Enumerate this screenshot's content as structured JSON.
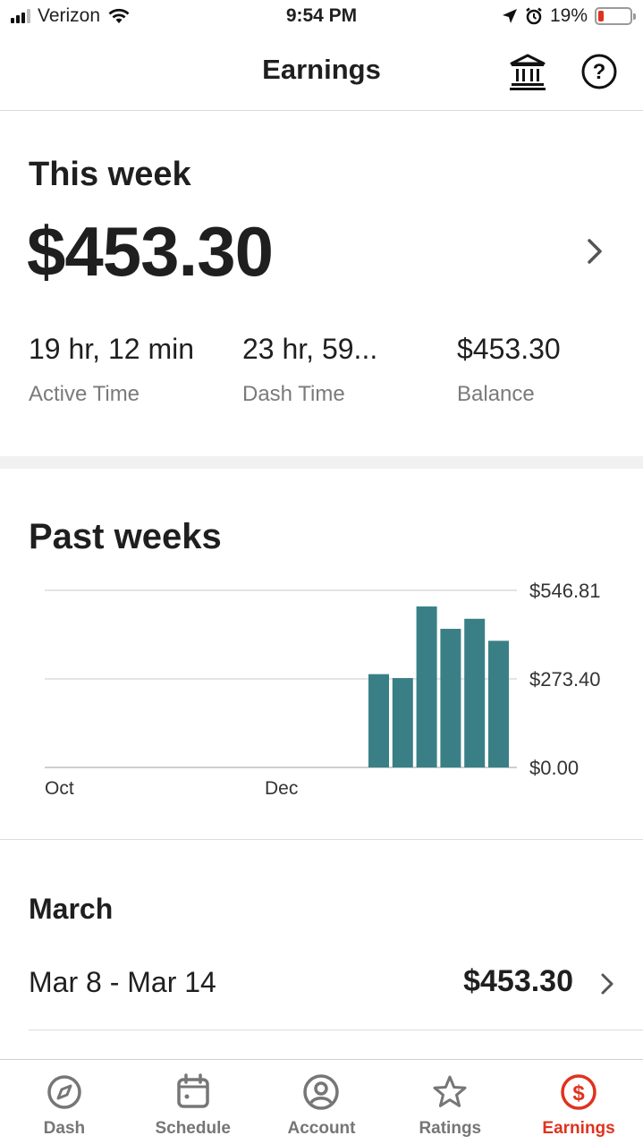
{
  "status_bar": {
    "carrier": "Verizon",
    "time": "9:54 PM",
    "battery": "19%",
    "battery_level": 0.19
  },
  "header": {
    "title": "Earnings",
    "icons": [
      "bank-icon",
      "help-icon"
    ]
  },
  "this_week": {
    "title": "This week",
    "amount": "$453.30",
    "stats": [
      {
        "value": "19 hr, 12 min",
        "label": "Active Time"
      },
      {
        "value": "23 hr, 59...",
        "label": "Dash Time"
      },
      {
        "value": "$453.30",
        "label": "Balance"
      }
    ]
  },
  "past_weeks": {
    "title": "Past weeks"
  },
  "chart_data": {
    "type": "bar",
    "categories": [
      "",
      "",
      "",
      "",
      "",
      ""
    ],
    "values": [
      288,
      276,
      497,
      428,
      459,
      391
    ],
    "title": "",
    "xlabel": "",
    "ylabel": "",
    "ylim": [
      0,
      546.81
    ],
    "y_ticks": [
      "$546.81",
      "$273.40",
      "$0.00"
    ],
    "x_ticks": [
      "Oct",
      "Dec"
    ],
    "grid": true,
    "bar_color": "#3a7f86"
  },
  "month_section": {
    "title": "March",
    "weeks": [
      {
        "range": "Mar 8 - Mar 14",
        "amount": "$453.30"
      }
    ]
  },
  "tab_bar": {
    "tabs": [
      {
        "label": "Dash",
        "icon": "compass-icon"
      },
      {
        "label": "Schedule",
        "icon": "calendar-icon"
      },
      {
        "label": "Account",
        "icon": "account-icon"
      },
      {
        "label": "Ratings",
        "icon": "star-icon"
      },
      {
        "label": "Earnings",
        "icon": "dollar-icon",
        "active": true
      }
    ],
    "accent_color": "#e0321e"
  }
}
